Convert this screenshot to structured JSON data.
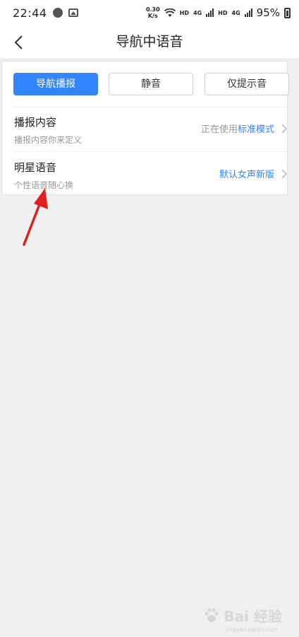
{
  "status_bar": {
    "time": "22:44",
    "net_speed_value": "0.30",
    "net_speed_unit": "K/s",
    "hd1": "HD",
    "sig1": "4G",
    "hd2": "HD",
    "sig2": "4G",
    "battery": "95%"
  },
  "header": {
    "title": "导航中语音"
  },
  "modes": [
    {
      "label": "导航播报",
      "active": true
    },
    {
      "label": "静音",
      "active": false
    },
    {
      "label": "仅提示音",
      "active": false
    }
  ],
  "rows": [
    {
      "title": "播报内容",
      "subtitle": "播报内容你来定义",
      "value_prefix": "正在使用",
      "value_accent": "标准模式"
    },
    {
      "title": "明星语音",
      "subtitle": "个性语音随心换",
      "value_prefix": "",
      "value_accent": "默认女声新版"
    }
  ],
  "watermark": {
    "text": "Bai 经验",
    "sub": "jingyan.baidu.com"
  },
  "colors": {
    "accent": "#3385ff",
    "annotation": "#e02020"
  }
}
